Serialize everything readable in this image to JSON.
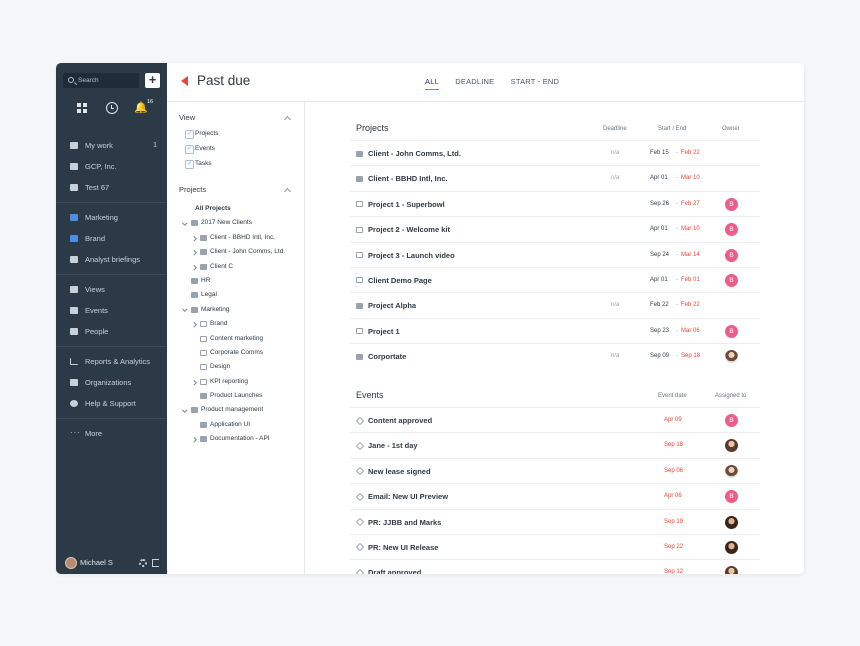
{
  "sidebar": {
    "search_placeholder": "Search",
    "plus": "+",
    "notif_count": "16",
    "bell": "🔔",
    "groups": [
      [
        {
          "label": "My work",
          "count": "1",
          "icon": "check-icon"
        },
        {
          "label": "GCP, Inc.",
          "icon": "briefcase-icon"
        },
        {
          "label": "Test 67",
          "icon": "briefcase-icon"
        }
      ],
      [
        {
          "label": "Marketing",
          "icon": "folder-icon"
        },
        {
          "label": "Brand",
          "icon": "brand-icon"
        },
        {
          "label": "Analyst briefings",
          "icon": "clipboard-icon"
        }
      ],
      [
        {
          "label": "Views",
          "icon": "views-icon"
        },
        {
          "label": "Events",
          "icon": "calendar-icon"
        },
        {
          "label": "People",
          "icon": "people-icon"
        }
      ],
      [
        {
          "label": "Reports & Analytics",
          "icon": "bar-chart-icon"
        },
        {
          "label": "Organizations",
          "icon": "building-icon"
        },
        {
          "label": "Help & Support",
          "icon": "help-icon"
        }
      ],
      [
        {
          "label": "More",
          "icon": "more-icon"
        }
      ]
    ],
    "user": "Michael S"
  },
  "header": {
    "title": "Past due",
    "tabs": [
      "ALL",
      "DEADLINE",
      "START - END"
    ]
  },
  "filter": {
    "view_label": "View",
    "view_items": [
      "Projects",
      "Events",
      "Tasks"
    ],
    "projects_label": "Projects",
    "tree": [
      {
        "label": "All Projects",
        "depth": 0,
        "caret": "none",
        "icon": "none",
        "bold": true
      },
      {
        "label": "2017 New Clients",
        "depth": 0,
        "caret": "down",
        "icon": "folder"
      },
      {
        "label": "Client - BBHD Intl, Inc.",
        "depth": 1,
        "caret": "right",
        "icon": "folder"
      },
      {
        "label": "Client - John Comms, Ltd.",
        "depth": 1,
        "caret": "right",
        "icon": "folder"
      },
      {
        "label": "Client C",
        "depth": 1,
        "caret": "right",
        "icon": "folder"
      },
      {
        "label": "HR",
        "depth": 0,
        "caret": "none",
        "icon": "folder"
      },
      {
        "label": "Legal",
        "depth": 0,
        "caret": "none",
        "icon": "folder"
      },
      {
        "label": "Marketing",
        "depth": 0,
        "caret": "down",
        "icon": "folder"
      },
      {
        "label": "Brand",
        "depth": 1,
        "caret": "right",
        "icon": "page"
      },
      {
        "label": "Content marketing",
        "depth": 1,
        "caret": "none",
        "icon": "page"
      },
      {
        "label": "Corporate Comms",
        "depth": 1,
        "caret": "none",
        "icon": "page"
      },
      {
        "label": "Design",
        "depth": 1,
        "caret": "none",
        "icon": "page"
      },
      {
        "label": "KPI reporting",
        "depth": 1,
        "caret": "right",
        "icon": "page"
      },
      {
        "label": "Product Launches",
        "depth": 1,
        "caret": "none",
        "icon": "folder"
      },
      {
        "label": "Product management",
        "depth": 0,
        "caret": "down",
        "icon": "folder"
      },
      {
        "label": "Application UI",
        "depth": 1,
        "caret": "none",
        "icon": "folder"
      },
      {
        "label": "Documentation - API",
        "depth": 1,
        "caret": "right",
        "icon": "folder"
      }
    ]
  },
  "projects": {
    "heading": "Projects",
    "col_deadline": "Deadline",
    "col_startend": "Start / End",
    "col_owner": "Owner",
    "rows": [
      {
        "name": "Client - John Comms, Ltd.",
        "icon": "folder",
        "deadline": "n/a",
        "start": "Feb 15",
        "end": "Feb 22",
        "avatar": ""
      },
      {
        "name": "Client - BBHD Intl, Inc.",
        "icon": "folder",
        "deadline": "n/a",
        "start": "Apr 01",
        "end": "Mar 10",
        "avatar": ""
      },
      {
        "name": "Project 1 - Superbowl",
        "icon": "page",
        "deadline": "",
        "start": "Sep 26",
        "end": "Feb 27",
        "avatar": "B"
      },
      {
        "name": "Project 2 - Welcome kit",
        "icon": "page",
        "deadline": "",
        "start": "Apr 01",
        "end": "Mar 10",
        "avatar": "B"
      },
      {
        "name": "Project 3 - Launch video",
        "icon": "page",
        "deadline": "",
        "start": "Sep 24",
        "end": "Mar 14",
        "avatar": "B"
      },
      {
        "name": "Client Demo Page",
        "icon": "page",
        "deadline": "",
        "start": "Apr 01",
        "end": "Feb 01",
        "avatar": "B"
      },
      {
        "name": "Project Alpha",
        "icon": "folder",
        "deadline": "n/a",
        "start": "Feb 22",
        "end": "Feb 22",
        "avatar": ""
      },
      {
        "name": "Project 1",
        "icon": "page",
        "deadline": "",
        "start": "Sep 23",
        "end": "Mar 06",
        "avatar": "B"
      },
      {
        "name": "Corportate",
        "icon": "folder",
        "deadline": "n/a",
        "start": "Sep 09",
        "end": "Sep 18",
        "avatar": "photo2"
      }
    ]
  },
  "events": {
    "heading": "Events",
    "col_date": "Event date",
    "col_assigned": "Assigned to",
    "rows": [
      {
        "name": "Content approved",
        "date": "Apr 09",
        "avatar": "B"
      },
      {
        "name": "Jane - 1st day",
        "date": "Sep 18",
        "avatar": "photo1"
      },
      {
        "name": "New lease signed",
        "date": "Sep 06",
        "avatar": "photo2"
      },
      {
        "name": "Email: New UI Preview",
        "date": "Apr 06",
        "avatar": "B"
      },
      {
        "name": "PR: JJBB and Marks",
        "date": "Sep 19",
        "avatar": "photo3"
      },
      {
        "name": "PR: New UI Release",
        "date": "Sep 22",
        "avatar": "photo3"
      },
      {
        "name": "Draft approved",
        "date": "Sep 12",
        "avatar": "photo1"
      }
    ]
  }
}
